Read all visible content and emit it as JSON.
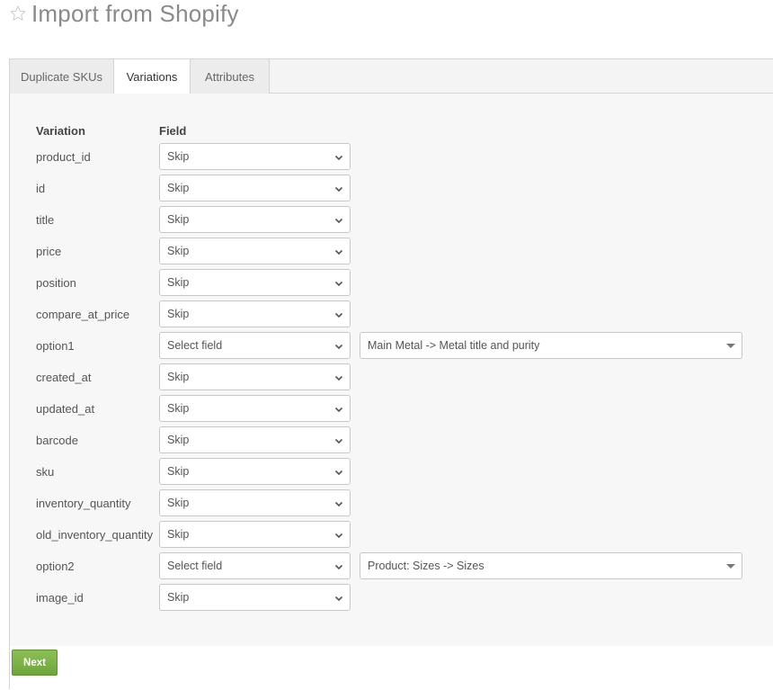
{
  "page": {
    "title": "Import from Shopify",
    "star_icon": "star-outline-icon"
  },
  "tabs": [
    {
      "label": "Duplicate SKUs",
      "active": false
    },
    {
      "label": "Variations",
      "active": true
    },
    {
      "label": "Attributes",
      "active": false
    }
  ],
  "headers": {
    "variation": "Variation",
    "field": "Field"
  },
  "rows": [
    {
      "label": "product_id",
      "field": "Skip"
    },
    {
      "label": "id",
      "field": "Skip"
    },
    {
      "label": "title",
      "field": "Skip"
    },
    {
      "label": "price",
      "field": "Skip"
    },
    {
      "label": "position",
      "field": "Skip"
    },
    {
      "label": "compare_at_price",
      "field": "Skip"
    },
    {
      "label": "option1",
      "field": "Select field",
      "mapping": "Main Metal -> Metal title and purity"
    },
    {
      "label": "created_at",
      "field": "Skip"
    },
    {
      "label": "updated_at",
      "field": "Skip"
    },
    {
      "label": "barcode",
      "field": "Skip"
    },
    {
      "label": "sku",
      "field": "Skip"
    },
    {
      "label": "inventory_quantity",
      "field": "Skip"
    },
    {
      "label": "old_inventory_quantity",
      "field": "Skip"
    },
    {
      "label": "option2",
      "field": "Select field",
      "mapping": "Product: Sizes -> Sizes"
    },
    {
      "label": "image_id",
      "field": "Skip"
    }
  ],
  "footer": {
    "next_label": "Next"
  },
  "colors": {
    "accent_green": "#7ab648",
    "border": "#d5d5d5",
    "title": "#8a8a8a"
  }
}
